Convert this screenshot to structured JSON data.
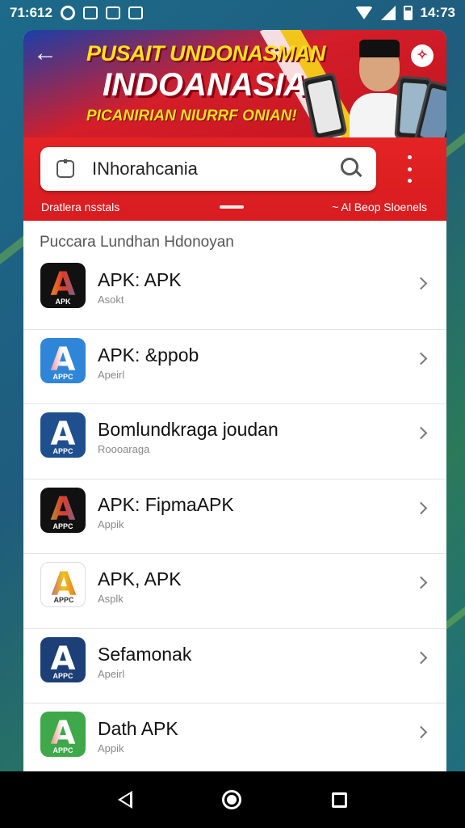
{
  "status_bar": {
    "time_left": "71:612",
    "time_right": "14:73"
  },
  "banner": {
    "line1": "PUSAIT UNDONASMAN",
    "line2": "INDOANASIA",
    "line3": "PICANIRIAN NIURRF ONIAN!"
  },
  "search": {
    "value": "INhorahcania"
  },
  "subbar": {
    "left": "Dratlera nsstals",
    "right": "~ Al Beop Sloenels"
  },
  "section_title": "Puccara Lundhan Hdonoyan",
  "apps": [
    {
      "name": "APK: APK",
      "sub": "Asokt",
      "tag": "APK",
      "bg": "#111111",
      "colors": [
        "#f2c31a",
        "#e03a2a",
        "#2a8ad6"
      ]
    },
    {
      "name": "APK: &ppob",
      "sub": "Apeirl",
      "tag": "APPC",
      "bg": "#2f86d8",
      "colors": [
        "#e63a52",
        "#ffffff",
        "#ffffff"
      ]
    },
    {
      "name": "Bomlundkraga joudan",
      "sub": "Roooaraga",
      "tag": "APPC",
      "bg": "#1f4f8f",
      "colors": [
        "#ffffff",
        "#ffffff",
        "#ffffff"
      ]
    },
    {
      "name": "APK: FipmaAPK",
      "sub": "Appik",
      "tag": "APPC",
      "bg": "#111111",
      "colors": [
        "#8fd13a",
        "#e03a2a",
        "#2a8ad6"
      ]
    },
    {
      "name": "APK, APK",
      "sub": "Asplk",
      "tag": "APPC",
      "bg": "#ffffff",
      "colors": [
        "#9a2fc2",
        "#f2c31a",
        "#e03a2a"
      ]
    },
    {
      "name": "Sefamonak",
      "sub": "Apeirl",
      "tag": "APPC",
      "bg": "#1c3f78",
      "colors": [
        "#ffffff",
        "#ffffff",
        "#ffffff"
      ]
    },
    {
      "name": "Dath APK",
      "sub": "Appik",
      "tag": "APPC",
      "bg": "#3ea84a",
      "colors": [
        "#e03a2a",
        "#ffffff",
        "#ffffff"
      ]
    }
  ]
}
